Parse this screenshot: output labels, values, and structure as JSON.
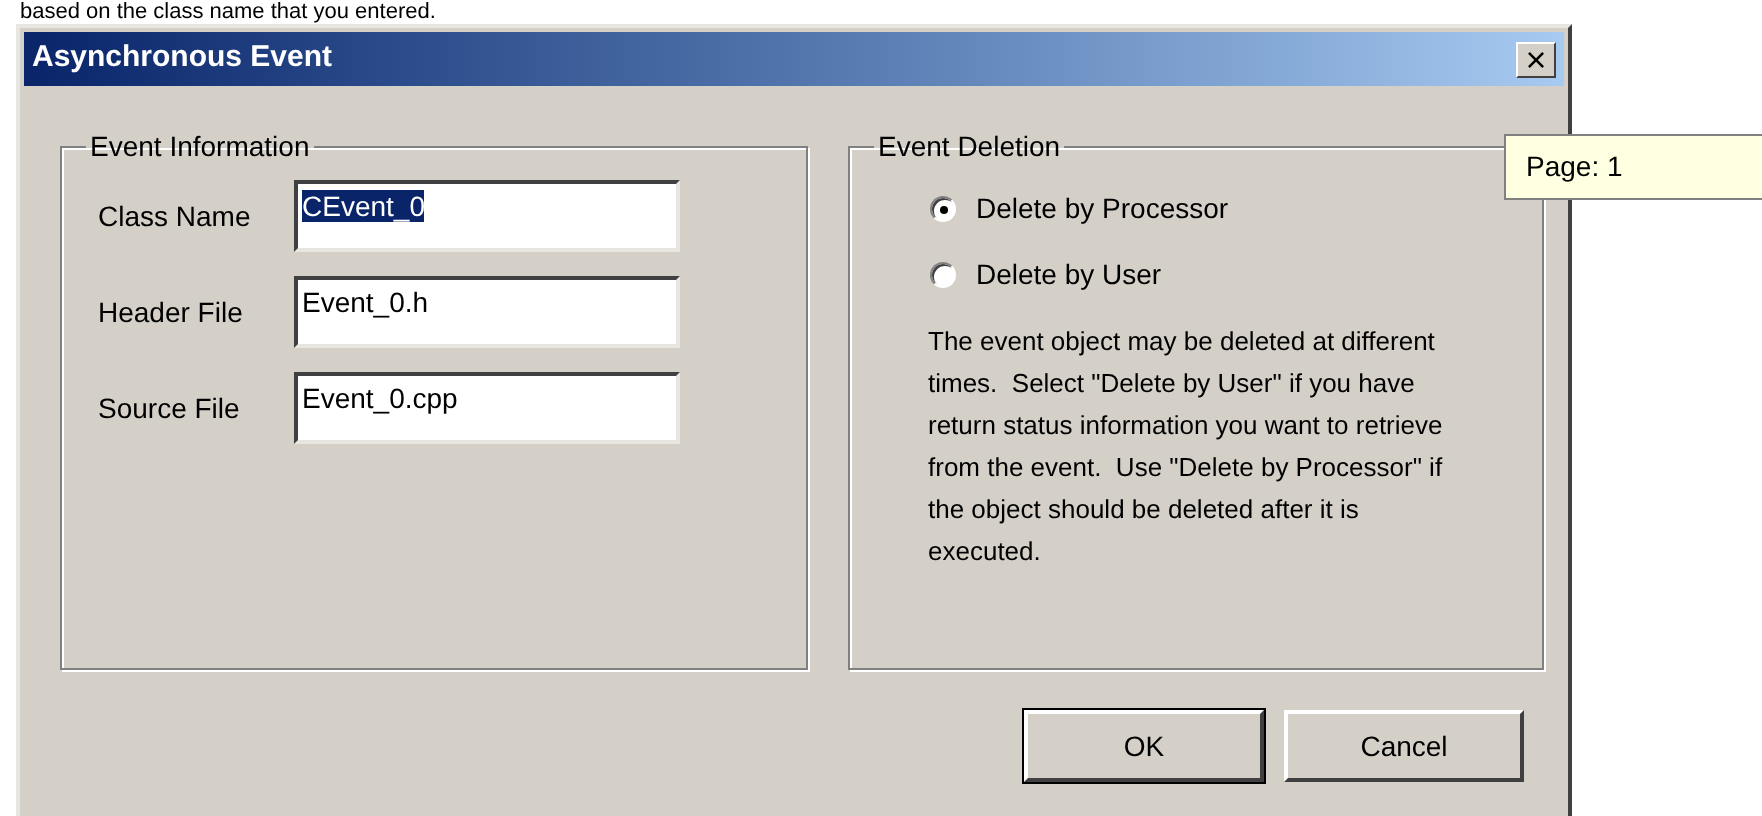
{
  "background_text": "based on the class name that you entered.",
  "window": {
    "title": "Asynchronous Event",
    "close_button": "×"
  },
  "event_information": {
    "title": "Event Information",
    "fields": [
      {
        "label": "Class Name",
        "value": "CEvent_0",
        "text_selected": true
      },
      {
        "label": "Header File",
        "value": "Event_0.h",
        "text_selected": false
      },
      {
        "label": "Source File",
        "value": "Event_0.cpp",
        "text_selected": false
      }
    ]
  },
  "event_deletion": {
    "title": "Event Deletion",
    "options": [
      {
        "label": "Delete by Processor",
        "selected": true
      },
      {
        "label": "Delete by User",
        "selected": false
      }
    ],
    "description": "The event object may be deleted at different times.  Select \"Delete by User\" if you have return status information you want to retrieve from the event.  Use \"Delete by Processor\" if the object should be deleted after it is executed."
  },
  "buttons": [
    {
      "label": "OK",
      "default": true
    },
    {
      "label": "Cancel",
      "default": false
    }
  ],
  "tooltip": "Page: 1"
}
